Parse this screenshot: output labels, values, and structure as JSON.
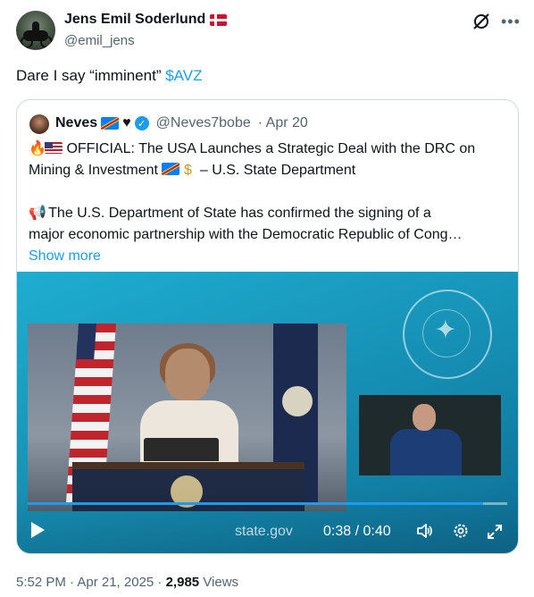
{
  "author": {
    "name": "Jens Emil Soderlund",
    "handle": "@emil_jens"
  },
  "tweet": {
    "text": "Dare I say “imminent” ",
    "cashtag": "$AVZ"
  },
  "quote": {
    "name": "Neves",
    "handle": "@Neves7bobe",
    "date": "· Apr 20",
    "line1": "OFFICIAL: The USA Launches a Strategic Deal with the DRC on",
    "line2a": "Mining & Investment",
    "line2b": " – U.S. State Department",
    "line3": "The U.S. Department of State has confirmed the signing of a",
    "line4": "major economic partnership with the Democratic Republic of Cong…",
    "show_more": "Show more"
  },
  "video": {
    "watermark": "state.gov",
    "time": "0:38 / 0:40",
    "progress_fraction": 0.95
  },
  "footer": {
    "time": "5:52 PM · Apr 21, 2025 · ",
    "views": "2,985",
    "views_label": " Views"
  },
  "icons": {
    "grok": "grok-slash-icon",
    "more": "more-dots-icon",
    "play": "play-icon",
    "volume": "volume-icon",
    "settings": "gear-icon",
    "fullscreen": "fullscreen-icon"
  },
  "colors": {
    "accent": "#1d9bf0",
    "muted": "#536471"
  }
}
